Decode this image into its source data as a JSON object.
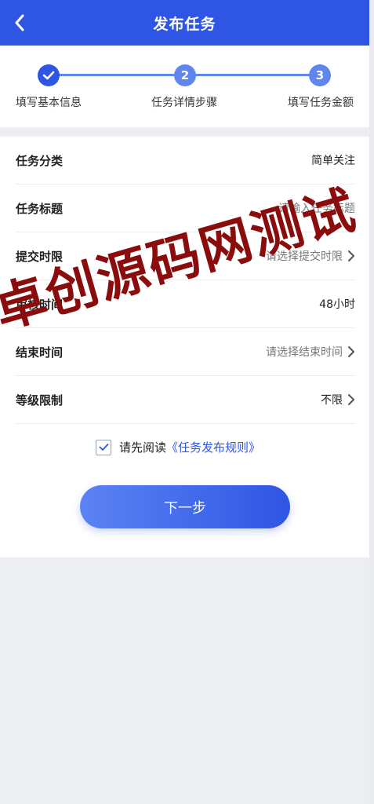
{
  "header": {
    "title": "发布任务"
  },
  "stepper": {
    "steps": [
      {
        "label": "填写基本信息",
        "number": ""
      },
      {
        "label": "任务详情步骤",
        "number": "2"
      },
      {
        "label": "填写任务金额",
        "number": "3"
      }
    ],
    "current_step": 1
  },
  "form": {
    "rows": [
      {
        "label": "任务分类",
        "value": "简单关注"
      },
      {
        "label": "任务标题",
        "placeholder": "请输入任务标题"
      },
      {
        "label": "提交时限",
        "placeholder": "请选择提交时限"
      },
      {
        "label": "审核时间",
        "value": "48小时"
      },
      {
        "label": "结束时间",
        "placeholder": "请选择结束时间"
      },
      {
        "label": "等级限制",
        "value": "不限"
      }
    ],
    "agree": {
      "checked": true,
      "text": "请先阅读",
      "link": "《任务发布规则》"
    },
    "next_label": "下一步"
  },
  "watermark": "卓创源码网测试",
  "colors": {
    "primary": "#2f55e4",
    "step_inactive": "#5f86ef",
    "watermark": "#8a0c0c"
  }
}
